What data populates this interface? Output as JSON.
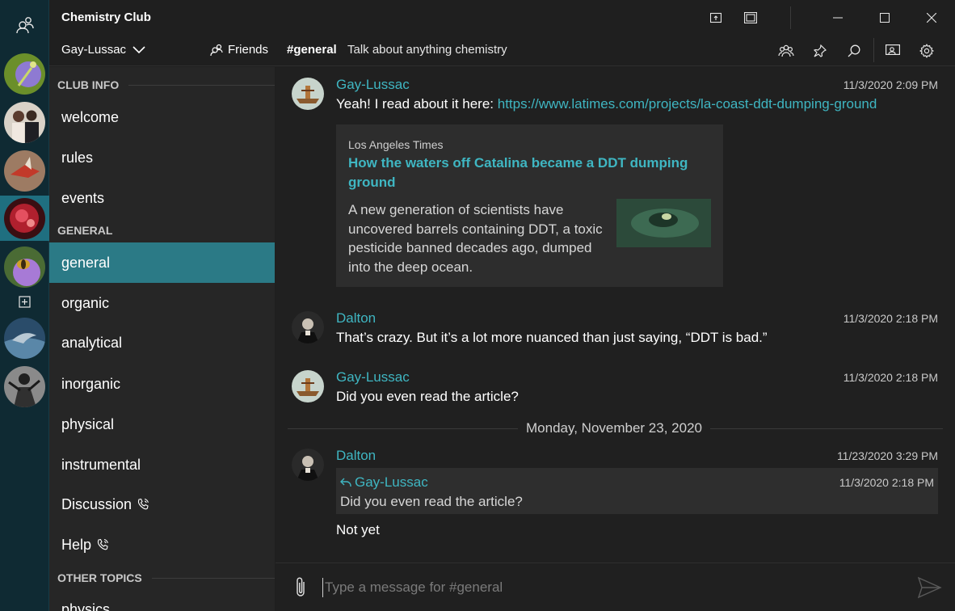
{
  "app": {
    "title": "Chemistry Club"
  },
  "user": {
    "name": "Gay-Lussac"
  },
  "nav": {
    "friends_label": "Friends"
  },
  "channel": {
    "name": "#general",
    "topic": "Talk about anything chemistry"
  },
  "colors": {
    "accent": "#3fb6c2",
    "active_channel": "#2b7a86",
    "rail": "#0f2a33"
  },
  "sidebar": {
    "sections": [
      {
        "label": "CLUB INFO",
        "channels": [
          {
            "label": "welcome"
          },
          {
            "label": "rules"
          },
          {
            "label": "events"
          }
        ]
      },
      {
        "label": "GENERAL",
        "channels": [
          {
            "label": "general",
            "active": true
          },
          {
            "label": "organic"
          },
          {
            "label": "analytical"
          },
          {
            "label": "inorganic"
          },
          {
            "label": "physical"
          },
          {
            "label": "instrumental"
          },
          {
            "label": "Discussion",
            "icon": "voice-call-icon"
          },
          {
            "label": "Help",
            "icon": "voice-call-icon"
          }
        ]
      },
      {
        "label": "OTHER TOPICS",
        "channels": [
          {
            "label": "physics"
          }
        ]
      }
    ]
  },
  "messages": [
    {
      "author": "Gay-Lussac",
      "timestamp": "11/3/2020 2:09 PM",
      "text": "Yeah! I read about it here: ",
      "link": "https://www.latimes.com/projects/la-coast-ddt-dumping-ground",
      "embed": {
        "source": "Los Angeles Times",
        "title": "How the waters off Catalina became a DDT dumping ground",
        "description": "A new generation of scientists have uncovered barrels containing DDT, a toxic pesticide banned decades ago, dumped into the deep ocean."
      }
    },
    {
      "author": "Dalton",
      "timestamp": "11/3/2020 2:18 PM",
      "text": "That’s crazy. But it’s a lot more nuanced than just saying, “DDT is bad.”"
    },
    {
      "author": "Gay-Lussac",
      "timestamp": "11/3/2020 2:18 PM",
      "text": "Did you even read the article?"
    },
    {
      "author": "Dalton",
      "timestamp": "11/23/2020 3:29 PM",
      "reply_to": {
        "author": "Gay-Lussac",
        "timestamp": "11/3/2020 2:18 PM",
        "text": "Did you even read the article?"
      },
      "text": "Not yet"
    }
  ],
  "date_divider": "Monday, November 23, 2020",
  "composer": {
    "placeholder": "Type a message for #general"
  }
}
